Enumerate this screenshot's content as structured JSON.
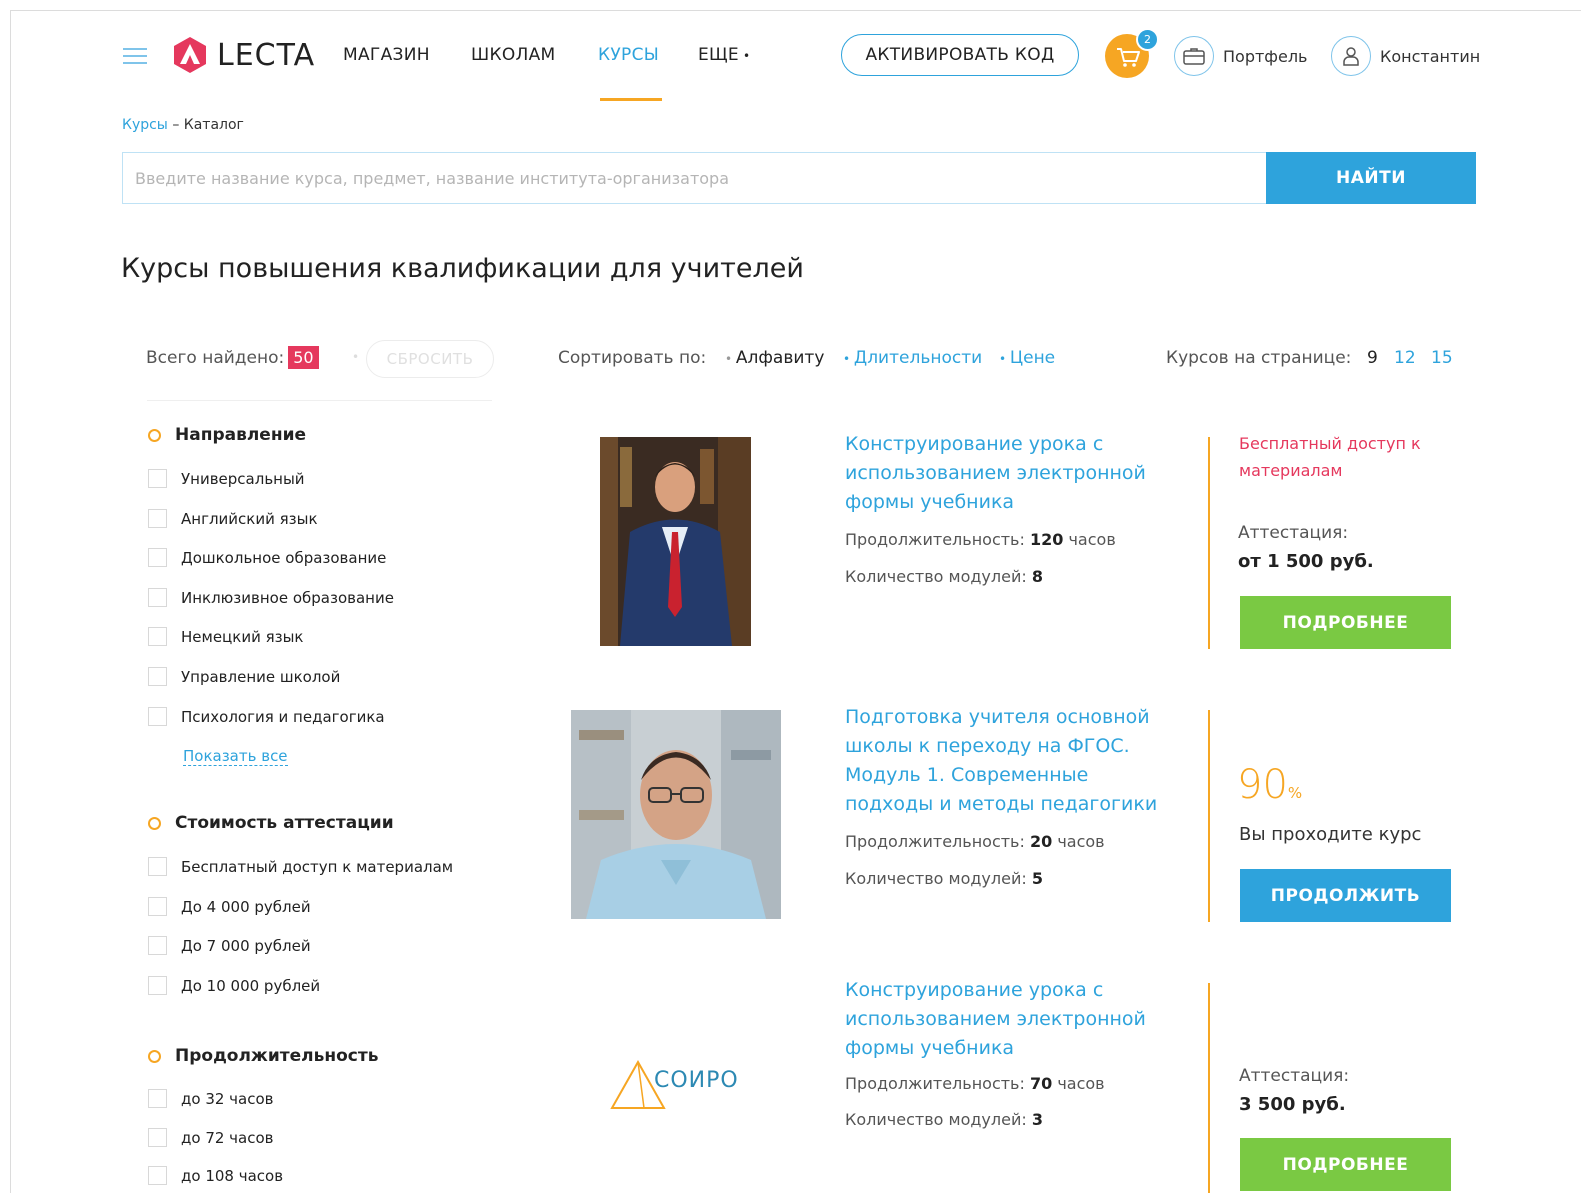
{
  "header": {
    "logo_text": "LECTA",
    "nav": [
      "МАГАЗИН",
      "ШКОЛАМ",
      "КУРСЫ",
      "ЕЩЕ"
    ],
    "active_nav": "КУРСЫ",
    "activate_label": "АКТИВИРОВАТЬ КОД",
    "cart_count": "2",
    "portfolio_label": "Портфель",
    "user_label": "Константин"
  },
  "breadcrumb": {
    "root": "Курсы",
    "separator": " – ",
    "current": "Каталог"
  },
  "search": {
    "placeholder": "Введите название курса, предмет, название института-организатора",
    "button": "НАЙТИ"
  },
  "page_title": "Курсы повышения квалификации для учителей",
  "toolbar": {
    "found_label": "Всего найдено:",
    "found_count": "50",
    "reset_label": "СБРОСИТЬ",
    "sort_label": "Сортировать по:",
    "sort_options": [
      "Алфавиту",
      "Длительности",
      "Цене"
    ],
    "sort_active": "Алфавиту",
    "per_page_label": "Курсов на странице:",
    "per_page_options": [
      "9",
      "12",
      "15"
    ],
    "per_page_active": "9"
  },
  "filters": {
    "direction": {
      "title": "Направление",
      "items": [
        "Универсальный",
        "Английский язык",
        "Дошкольное образование",
        "Инклюзивное образование",
        "Немецкий язык",
        "Управление школой",
        "Психология и педагогика"
      ],
      "show_all": "Показать все"
    },
    "cost": {
      "title": "Стоимость аттестации",
      "items": [
        "Бесплатный доступ к материалам",
        "До 4 000 рублей",
        "До 7 000 рублей",
        "До 10 000 рублей"
      ]
    },
    "duration": {
      "title": "Продолжительность",
      "items": [
        "до 32 часов",
        "до 72 часов",
        "до 108 часов"
      ]
    }
  },
  "labels": {
    "duration": "Продолжительность:",
    "hours": "часов",
    "modules": "Количество модулей:",
    "attestation": "Аттестация:"
  },
  "courses": [
    {
      "title": "Конструирование урока с использованием электронной формы учебника",
      "duration": "120",
      "modules": "8",
      "free_access": "Бесплатный доступ к материалам",
      "price": "от 1 500 руб.",
      "button": "ПОДРОБНЕЕ"
    },
    {
      "title": "Подготовка учителя основной школы к переходу на ФГОС. Модуль 1. Современные подходы и методы педагогики",
      "duration": "20",
      "modules": "5",
      "progress": "90",
      "progress_unit": "%",
      "progress_text": "Вы проходите курс",
      "button": "ПРОДОЛЖИТЬ"
    },
    {
      "title": "Конструирование урока с использованием электронной формы учебника",
      "duration": "70",
      "modules": "3",
      "logo_text": "СОИРО",
      "price": "3 500 руб.",
      "button": "ПОДРОБНЕЕ"
    }
  ],
  "colors": {
    "accent_blue": "#2ea3dc",
    "accent_orange": "#f6a623",
    "accent_red": "#e5385d",
    "accent_green": "#7ac943"
  }
}
